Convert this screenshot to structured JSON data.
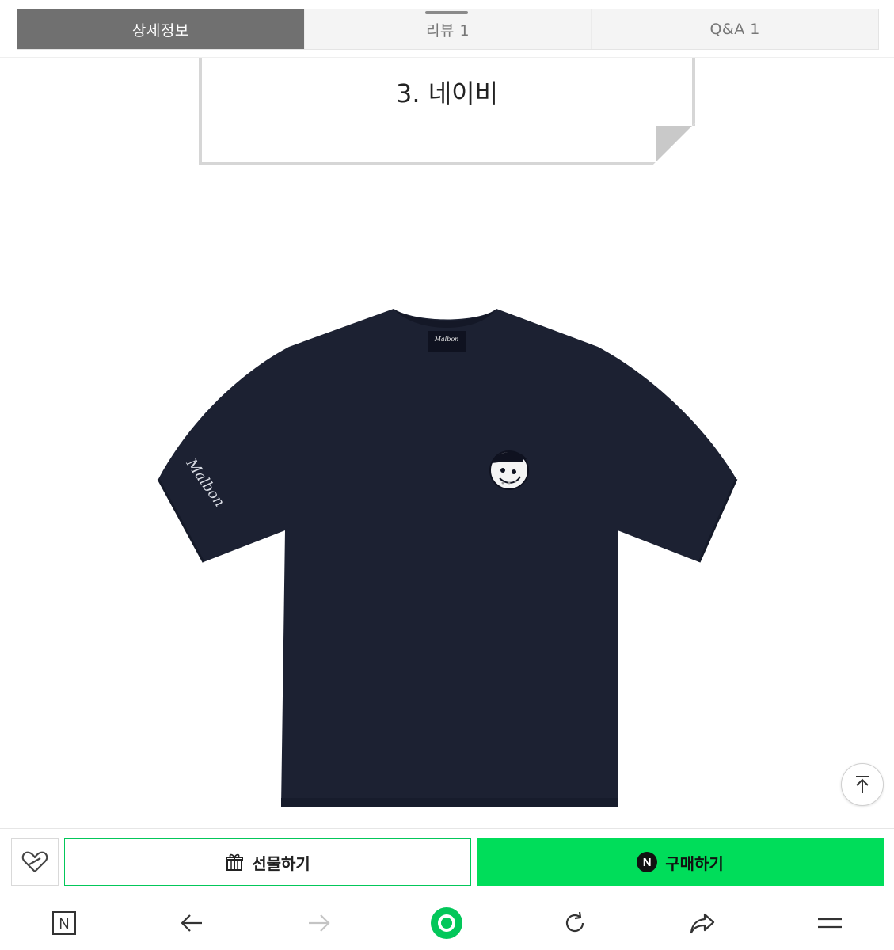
{
  "tabs": {
    "details": "상세정보",
    "reviews": "리뷰  1",
    "qna": "Q&A  1"
  },
  "note": {
    "text": "3. 네이비"
  },
  "product_image": {
    "description_icon": "navy-tshirt",
    "shirt_color": "#1c2132",
    "sleeve_script": "Malbon",
    "label_script": "Malbon"
  },
  "actions": {
    "wishlist_icon": "heart-icon",
    "gift_label": "선물하기",
    "buy_label": "구매하기",
    "buy_badge": "N",
    "buy_color": "#00dd5a",
    "gift_border_color": "#03c75a"
  },
  "nav": {
    "home_icon": "naver-n-icon",
    "back_icon": "back-arrow-icon",
    "forward_icon": "forward-arrow-icon",
    "center_icon": "green-dot-icon",
    "reload_icon": "reload-icon",
    "share_icon": "share-icon",
    "menu_icon": "menu-icon",
    "home_label": "N"
  }
}
